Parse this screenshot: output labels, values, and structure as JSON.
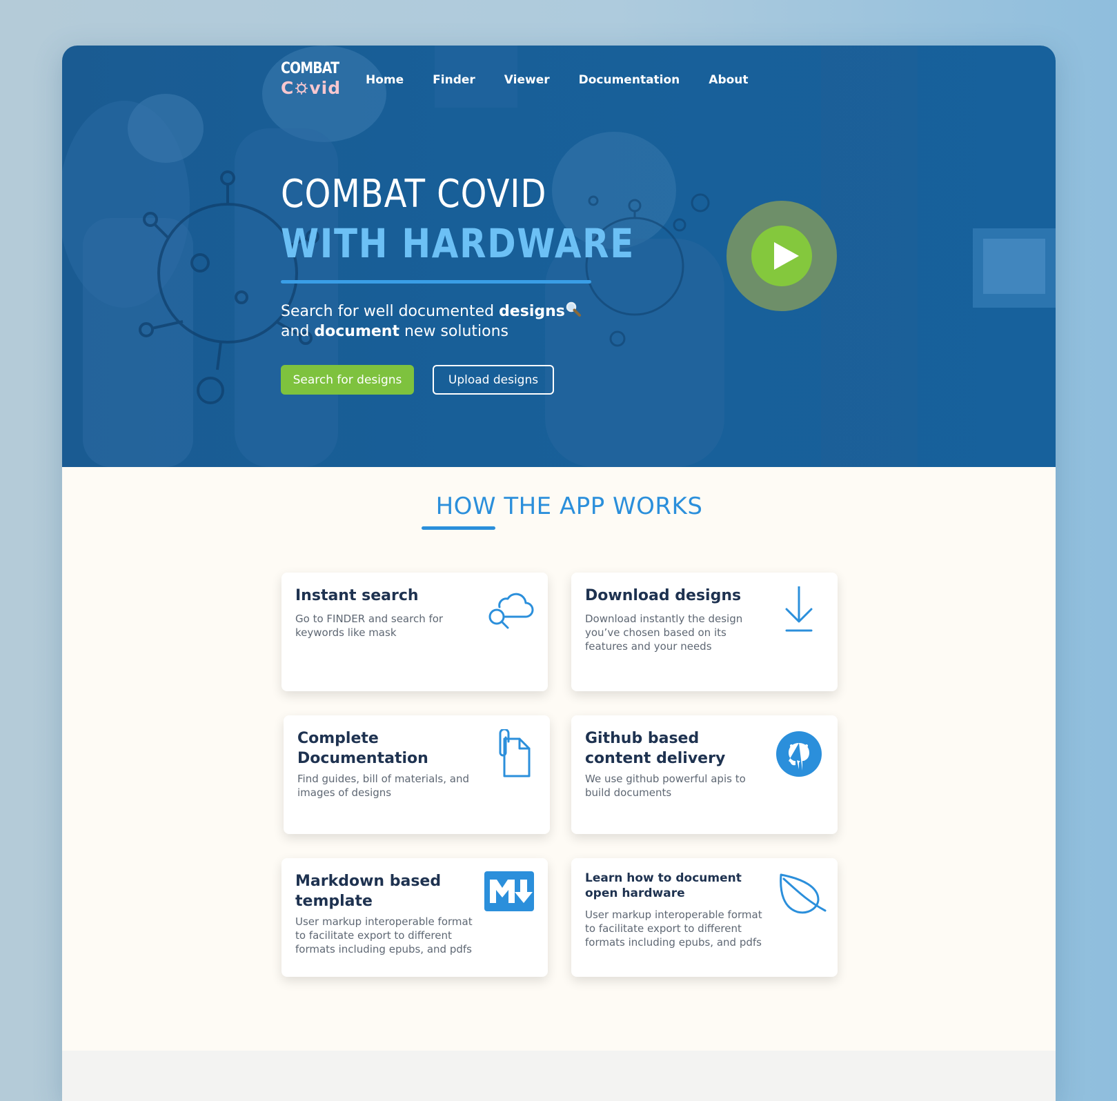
{
  "nav": {
    "logo_top": "COMBAT",
    "logo_bottom_left": "C",
    "logo_bottom_right": "vid",
    "links": [
      "Home",
      "Finder",
      "Viewer",
      "Documentation",
      "About"
    ]
  },
  "hero": {
    "title_line1": "COMBAT COVID",
    "title_line2": "WITH HARDWARE",
    "sub_part1": "Search for well documented ",
    "sub_bold1": "designs",
    "sub_part2": "and ",
    "sub_bold2": "document",
    "sub_part3": " new solutions",
    "search_button": "Search for designs",
    "upload_button": "Upload designs",
    "play_icon": "play-icon"
  },
  "how": {
    "title": "HOW THE APP WORKS",
    "cards": [
      {
        "title": "Instant search",
        "desc": "Go to FINDER and search for keywords like mask",
        "icon": "cloud-search-icon"
      },
      {
        "title": "Download designs",
        "desc": "Download instantly the design you’ve chosen based on its features and your needs",
        "icon": "download-icon"
      },
      {
        "title": "Complete Documentation",
        "desc": "Find guides, bill of materials, and images of designs",
        "icon": "document-clip-icon"
      },
      {
        "title": "Github based content delivery",
        "desc": "We use github powerful apis to build documents",
        "icon": "github-icon"
      },
      {
        "title": "Markdown based template",
        "desc": "User markup interoperable format to facilitate export to different formats including epubs, and pdfs",
        "icon": "markdown-icon"
      },
      {
        "title": "Learn how to document open hardware",
        "desc": "User markup interoperable format to facilitate export to different formats including epubs, and pdfs",
        "icon": "leaf-icon"
      }
    ]
  },
  "colors": {
    "hero_blue": "#1a5f9a",
    "accent_blue": "#2b8fdb",
    "light_blue_title": "#6cc0f5",
    "green_button": "#7ec23e",
    "card_title": "#1e3250",
    "logo_pink": "#f7c7cf"
  }
}
